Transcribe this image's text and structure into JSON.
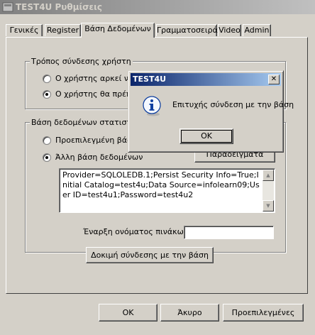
{
  "window": {
    "title": "TEST4U Ρυθμίσεις"
  },
  "tabs": [
    {
      "label": "Γενικές"
    },
    {
      "label": "Register"
    },
    {
      "label": "Βάση Δεδομένων"
    },
    {
      "label": "Γραμματοσειρά"
    },
    {
      "label": "Video"
    },
    {
      "label": "Admin"
    }
  ],
  "connection_group": {
    "legend": "Τρόπος σύνδεσης χρήστη",
    "option1": "Ο χρήστης αρκεί να",
    "option2": "Ο χρήστης θα πρέπε"
  },
  "database_group": {
    "legend": "Βάση δεδομένων στατιστι",
    "option1": "Προεπιλεγμένη βάση",
    "option2": "Άλλη βάση δεδομένων",
    "examples_button": "Παραδείγματα",
    "connection_string": "Provider=SQLOLEDB.1;Persist Security Info=True;Initial Catalog=test4u;Data Source=infolearn09;User ID=test4u1;Password=test4u2"
  },
  "table_prefix": {
    "label": "Έναρξη ονόματος πινάκων:",
    "value": ""
  },
  "test_button": "Δοκιμή σύνδεσης με την βάση",
  "footer": {
    "ok": "OK",
    "cancel": "Άκυρο",
    "defaults": "Προεπιλεγμένες"
  },
  "dialog": {
    "title": "TEST4U",
    "message": "Επιτυχής σύνδεση με την βάση",
    "ok": "OK",
    "close_glyph": "✕",
    "icon": "info-icon"
  }
}
